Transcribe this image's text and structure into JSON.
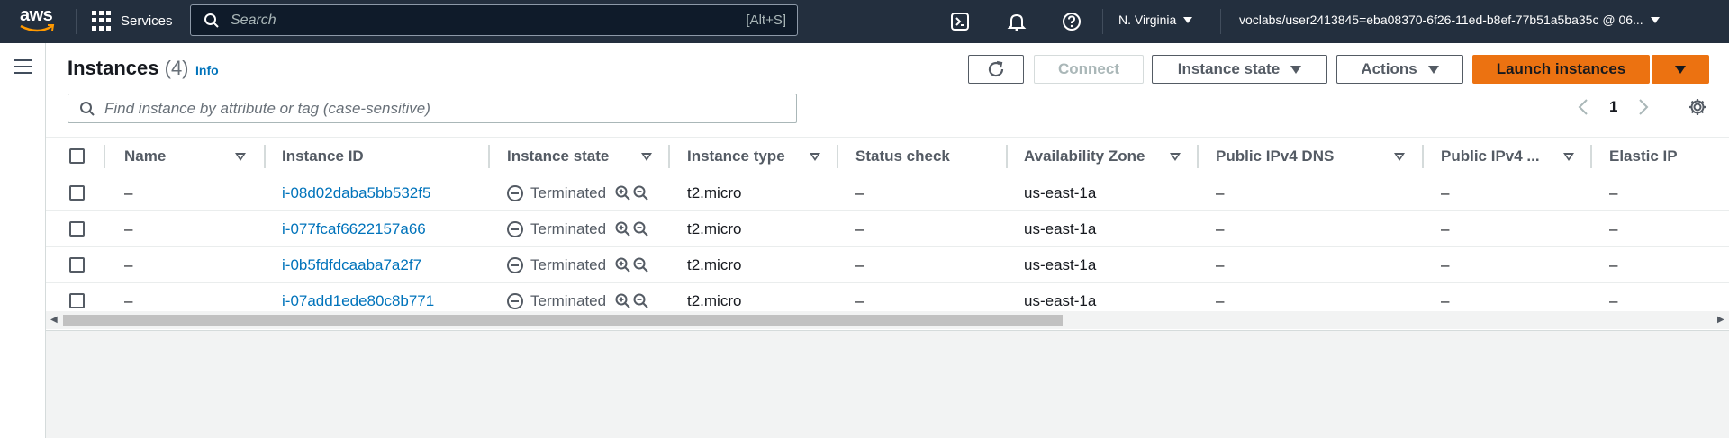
{
  "nav": {
    "logo": "aws",
    "services_label": "Services",
    "search_placeholder": "Search",
    "search_shortcut": "[Alt+S]",
    "region": "N. Virginia",
    "user": "voclabs/user2413845=eba08370-6f26-11ed-b8ef-77b51a5ba35c @ 06..."
  },
  "page": {
    "title": "Instances",
    "count": "(4)",
    "info": "Info",
    "filter_placeholder": "Find instance by attribute or tag (case-sensitive)",
    "page_number": "1"
  },
  "buttons": {
    "connect": "Connect",
    "instance_state": "Instance state",
    "actions": "Actions",
    "launch": "Launch instances"
  },
  "table": {
    "columns": [
      "Name",
      "Instance ID",
      "Instance state",
      "Instance type",
      "Status check",
      "Availability Zone",
      "Public IPv4 DNS",
      "Public IPv4 ...",
      "Elastic IP"
    ],
    "rows": [
      {
        "name": "–",
        "id": "i-08d02daba5bb532f5",
        "state": "Terminated",
        "type": "t2.micro",
        "status": "–",
        "az": "us-east-1a",
        "dns": "–",
        "ip": "–",
        "eip": "–"
      },
      {
        "name": "–",
        "id": "i-077fcaf6622157a66",
        "state": "Terminated",
        "type": "t2.micro",
        "status": "–",
        "az": "us-east-1a",
        "dns": "–",
        "ip": "–",
        "eip": "–"
      },
      {
        "name": "–",
        "id": "i-0b5fdfdcaaba7a2f7",
        "state": "Terminated",
        "type": "t2.micro",
        "status": "–",
        "az": "us-east-1a",
        "dns": "–",
        "ip": "–",
        "eip": "–"
      },
      {
        "name": "–",
        "id": "i-07add1ede80c8b771",
        "state": "Terminated",
        "type": "t2.micro",
        "status": "–",
        "az": "us-east-1a",
        "dns": "–",
        "ip": "–",
        "eip": "–"
      }
    ]
  },
  "colors": {
    "nav_bg": "#232f3e",
    "link": "#0073bb",
    "primary": "#ec7211"
  }
}
